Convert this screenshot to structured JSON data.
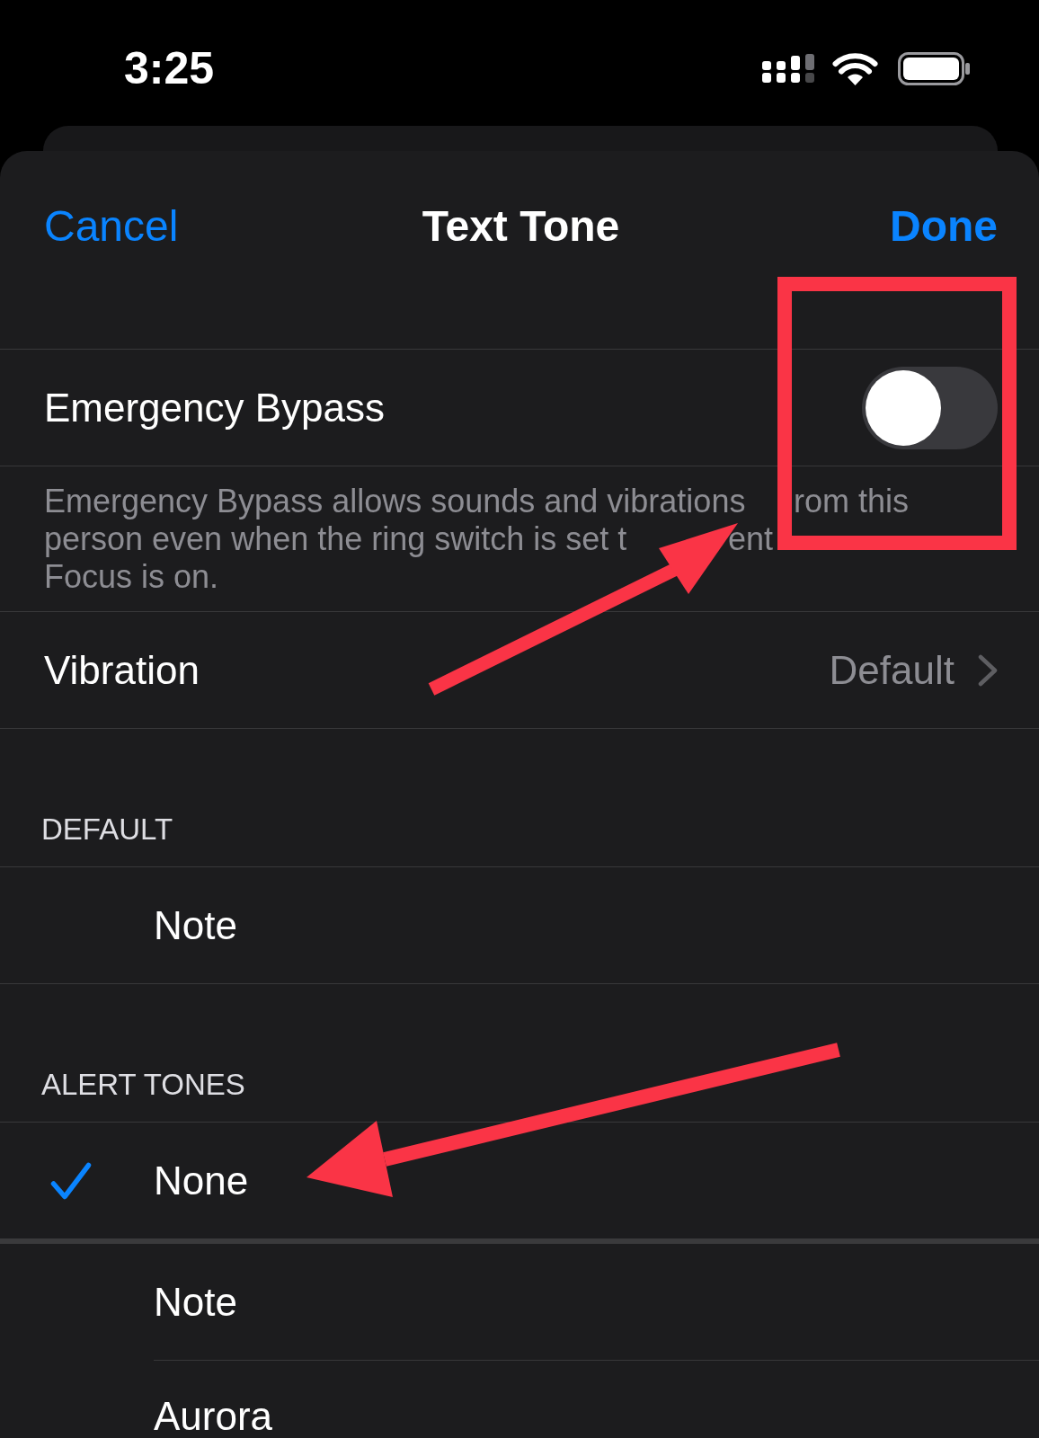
{
  "status_bar": {
    "time": "3:25"
  },
  "nav_bar": {
    "cancel": "Cancel",
    "title": "Text Tone",
    "done": "Done"
  },
  "emergency_bypass": {
    "label": "Emergency Bypass",
    "on": false,
    "footer": [
      [
        "Emergency Bypass allows sounds and vibrations",
        "rom this"
      ],
      [
        "person even when the ring switch is set t",
        "ent"
      ],
      [
        "Focus is on."
      ]
    ]
  },
  "vibration": {
    "label": "Vibration",
    "value": "Default"
  },
  "sections": [
    {
      "header": "DEFAULT",
      "tones": [
        {
          "name": "Note",
          "selected": false
        }
      ]
    },
    {
      "header": "ALERT TONES",
      "tones": [
        {
          "name": "None",
          "selected": true
        },
        {
          "name": "Note",
          "selected": false
        },
        {
          "name": "Aurora",
          "selected": false
        }
      ]
    }
  ]
}
